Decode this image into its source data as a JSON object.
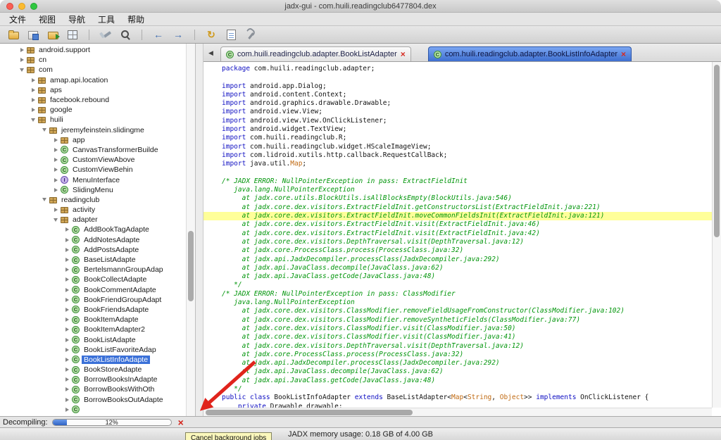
{
  "window": {
    "title": "jadx-gui - com.huili.readingclub6477804.dex"
  },
  "menu_bar": {
    "items": [
      {
        "id": "file",
        "label": "文件"
      },
      {
        "id": "view",
        "label": "视图"
      },
      {
        "id": "navigation",
        "label": "导航"
      },
      {
        "id": "tools",
        "label": "工具"
      },
      {
        "id": "help",
        "label": "帮助"
      }
    ]
  },
  "toolbar": {
    "buttons": [
      {
        "name": "open-file"
      },
      {
        "name": "save-all"
      },
      {
        "name": "export-gradle"
      },
      {
        "name": "reload"
      },
      {
        "sep": true
      },
      {
        "name": "deobfuscation"
      },
      {
        "name": "text-search"
      },
      {
        "sep": true
      },
      {
        "name": "nav-back",
        "glyph": "←"
      },
      {
        "name": "nav-forward",
        "glyph": "→"
      },
      {
        "sep": true
      },
      {
        "name": "sync",
        "glyph": "↻"
      },
      {
        "name": "log-viewer"
      },
      {
        "name": "preferences"
      }
    ]
  },
  "tree": {
    "items": [
      {
        "indent": 1,
        "arrow": "right",
        "icon": "package",
        "label": "android.support"
      },
      {
        "indent": 1,
        "arrow": "right",
        "icon": "package",
        "label": "cn"
      },
      {
        "indent": 1,
        "arrow": "down",
        "icon": "package",
        "label": "com"
      },
      {
        "indent": 2,
        "arrow": "right",
        "icon": "package",
        "label": "amap.api.location"
      },
      {
        "indent": 2,
        "arrow": "right",
        "icon": "package",
        "label": "aps"
      },
      {
        "indent": 2,
        "arrow": "right",
        "icon": "package",
        "label": "facebook.rebound"
      },
      {
        "indent": 2,
        "arrow": "right",
        "icon": "package",
        "label": "google"
      },
      {
        "indent": 2,
        "arrow": "down",
        "icon": "package",
        "label": "huili"
      },
      {
        "indent": 3,
        "arrow": "down",
        "icon": "package",
        "label": "jeremyfeinstein.slidingme"
      },
      {
        "indent": 4,
        "arrow": "right",
        "icon": "package",
        "label": "app"
      },
      {
        "indent": 4,
        "arrow": "right",
        "icon": "class",
        "label": "CanvasTransformerBuilde"
      },
      {
        "indent": 4,
        "arrow": "right",
        "icon": "class",
        "label": "CustomViewAbove"
      },
      {
        "indent": 4,
        "arrow": "right",
        "icon": "class",
        "label": "CustomViewBehin"
      },
      {
        "indent": 4,
        "arrow": "right",
        "icon": "interface",
        "label": "MenuInterface"
      },
      {
        "indent": 4,
        "arrow": "right",
        "icon": "class",
        "label": "SlidingMenu"
      },
      {
        "indent": 3,
        "arrow": "down",
        "icon": "package",
        "label": "readingclub"
      },
      {
        "indent": 4,
        "arrow": "right",
        "icon": "package",
        "label": "activity"
      },
      {
        "indent": 4,
        "arrow": "down",
        "icon": "package",
        "label": "adapter"
      },
      {
        "indent": 5,
        "arrow": "right",
        "icon": "class",
        "label": "AddBookTagAdapte"
      },
      {
        "indent": 5,
        "arrow": "right",
        "icon": "class",
        "label": "AddNotesAdapte"
      },
      {
        "indent": 5,
        "arrow": "right",
        "icon": "class",
        "label": "AddPostsAdapte"
      },
      {
        "indent": 5,
        "arrow": "right",
        "icon": "class",
        "label": "BaseListAdapte"
      },
      {
        "indent": 5,
        "arrow": "right",
        "icon": "class",
        "label": "BertelsmannGroupAdap"
      },
      {
        "indent": 5,
        "arrow": "right",
        "icon": "class",
        "label": "BookCollectAdapte"
      },
      {
        "indent": 5,
        "arrow": "right",
        "icon": "class",
        "label": "BookCommentAdapte"
      },
      {
        "indent": 5,
        "arrow": "right",
        "icon": "class",
        "label": "BookFriendGroupAdapt"
      },
      {
        "indent": 5,
        "arrow": "right",
        "icon": "class",
        "label": "BookFriendsAdapte"
      },
      {
        "indent": 5,
        "arrow": "right",
        "icon": "class",
        "label": "BookItemAdapte"
      },
      {
        "indent": 5,
        "arrow": "right",
        "icon": "class",
        "label": "BookItemAdapter2"
      },
      {
        "indent": 5,
        "arrow": "right",
        "icon": "class",
        "label": "BookListAdapte"
      },
      {
        "indent": 5,
        "arrow": "right",
        "icon": "class",
        "label": "BookListFavoriteAdap"
      },
      {
        "indent": 5,
        "arrow": "right",
        "icon": "class",
        "label": "BookListInfoAdapte",
        "selected": true
      },
      {
        "indent": 5,
        "arrow": "right",
        "icon": "class",
        "label": "BookStoreAdapte"
      },
      {
        "indent": 5,
        "arrow": "right",
        "icon": "class",
        "label": "BorrowBooksInAdapte"
      },
      {
        "indent": 5,
        "arrow": "right",
        "icon": "class",
        "label": "BorrowBooksWithOth"
      },
      {
        "indent": 5,
        "arrow": "right",
        "icon": "class",
        "label": "BorrowBooksOutAdapte"
      },
      {
        "indent": 5,
        "arrow": "right",
        "icon": "class",
        "label": ""
      }
    ]
  },
  "tabs": {
    "items": [
      {
        "label": "com.huili.readingclub.adapter.BookListAdapter",
        "active": false
      },
      {
        "label": "com.huili.readingclub.adapter.BookListInfoAdapter",
        "active": true
      }
    ]
  },
  "editor": {
    "lines": [
      {
        "x": [
          [
            "k",
            "package "
          ],
          [
            "p",
            "com.huili.readingclub.adapter;"
          ]
        ]
      },
      {
        "x": []
      },
      {
        "x": [
          [
            "k",
            "import "
          ],
          [
            "p",
            "android.app.Dialog;"
          ]
        ]
      },
      {
        "x": [
          [
            "k",
            "import "
          ],
          [
            "p",
            "android.content.Context;"
          ]
        ]
      },
      {
        "x": [
          [
            "k",
            "import "
          ],
          [
            "p",
            "android.graphics.drawable.Drawable;"
          ]
        ]
      },
      {
        "x": [
          [
            "k",
            "import "
          ],
          [
            "p",
            "android.view.View;"
          ]
        ]
      },
      {
        "x": [
          [
            "k",
            "import "
          ],
          [
            "p",
            "android.view.View.OnClickListener;"
          ]
        ]
      },
      {
        "x": [
          [
            "k",
            "import "
          ],
          [
            "p",
            "android.widget.TextView;"
          ]
        ]
      },
      {
        "x": [
          [
            "k",
            "import "
          ],
          [
            "p",
            "com.huili.readingclub.R;"
          ]
        ]
      },
      {
        "x": [
          [
            "k",
            "import "
          ],
          [
            "p",
            "com.huili.readingclub.widget.HScaleImageView;"
          ]
        ]
      },
      {
        "x": [
          [
            "k",
            "import "
          ],
          [
            "p",
            "com.lidroid.xutils.http.callback.RequestCallBack;"
          ]
        ]
      },
      {
        "x": [
          [
            "k",
            "import "
          ],
          [
            "p",
            "java.util."
          ],
          [
            "y",
            "Map"
          ],
          [
            "p",
            ";"
          ]
        ]
      },
      {
        "x": []
      },
      {
        "x": [
          [
            "c",
            "/* JADX ERROR: NullPointerException in pass: ExtractFieldInit"
          ]
        ]
      },
      {
        "x": [
          [
            "c",
            "   java.lang.NullPointerException"
          ]
        ]
      },
      {
        "x": [
          [
            "c",
            "     at jadx.core.utils.BlockUtils.isAllBlocksEmpty(BlockUtils.java:546)"
          ]
        ]
      },
      {
        "x": [
          [
            "c",
            "     at jadx.core.dex.visitors.ExtractFieldInit.getConstructorsList(ExtractFieldInit.java:221)"
          ]
        ]
      },
      {
        "h": true,
        "x": [
          [
            "c",
            "     at jadx.core.dex.visitors.ExtractFieldInit.moveCommonFieldsInit(ExtractFieldInit.java:121)"
          ]
        ]
      },
      {
        "x": [
          [
            "c",
            "     at jadx.core.dex.visitors.ExtractFieldInit.visit(ExtractFieldInit.java:46)"
          ]
        ]
      },
      {
        "x": [
          [
            "c",
            "     at jadx.core.dex.visitors.ExtractFieldInit.visit(ExtractFieldInit.java:42)"
          ]
        ]
      },
      {
        "x": [
          [
            "c",
            "     at jadx.core.dex.visitors.DepthTraversal.visit(DepthTraversal.java:12)"
          ]
        ]
      },
      {
        "x": [
          [
            "c",
            "     at jadx.core.ProcessClass.process(ProcessClass.java:32)"
          ]
        ]
      },
      {
        "x": [
          [
            "c",
            "     at jadx.api.JadxDecompiler.processClass(JadxDecompiler.java:292)"
          ]
        ]
      },
      {
        "x": [
          [
            "c",
            "     at jadx.api.JavaClass.decompile(JavaClass.java:62)"
          ]
        ]
      },
      {
        "x": [
          [
            "c",
            "     at jadx.api.JavaClass.getCode(JavaClass.java:48)"
          ]
        ]
      },
      {
        "x": [
          [
            "c",
            "   */"
          ]
        ]
      },
      {
        "x": [
          [
            "c",
            "/* JADX ERROR: NullPointerException in pass: ClassModifier"
          ]
        ]
      },
      {
        "x": [
          [
            "c",
            "   java.lang.NullPointerException"
          ]
        ]
      },
      {
        "x": [
          [
            "c",
            "     at jadx.core.dex.visitors.ClassModifier.removeFieldUsageFromConstructor(ClassModifier.java:102)"
          ]
        ]
      },
      {
        "x": [
          [
            "c",
            "     at jadx.core.dex.visitors.ClassModifier.removeSyntheticFields(ClassModifier.java:77)"
          ]
        ]
      },
      {
        "x": [
          [
            "c",
            "     at jadx.core.dex.visitors.ClassModifier.visit(ClassModifier.java:50)"
          ]
        ]
      },
      {
        "x": [
          [
            "c",
            "     at jadx.core.dex.visitors.ClassModifier.visit(ClassModifier.java:41)"
          ]
        ]
      },
      {
        "x": [
          [
            "c",
            "     at jadx.core.dex.visitors.DepthTraversal.visit(DepthTraversal.java:12)"
          ]
        ]
      },
      {
        "x": [
          [
            "c",
            "     at jadx.core.ProcessClass.process(ProcessClass.java:32)"
          ]
        ]
      },
      {
        "x": [
          [
            "c",
            "     at jadx.api.JadxDecompiler.processClass(JadxDecompiler.java:292)"
          ]
        ]
      },
      {
        "x": [
          [
            "c",
            "     at jadx.api.JavaClass.decompile(JavaClass.java:62)"
          ]
        ]
      },
      {
        "x": [
          [
            "c",
            "     at jadx.api.JavaClass.getCode(JavaClass.java:48)"
          ]
        ]
      },
      {
        "x": [
          [
            "c",
            "   */"
          ]
        ]
      },
      {
        "x": [
          [
            "k",
            "public class "
          ],
          [
            "p",
            "BookListInfoAdapter "
          ],
          [
            "k",
            "extends "
          ],
          [
            "p",
            "BaseListAdapter<"
          ],
          [
            "y",
            "Map"
          ],
          [
            "p",
            "<"
          ],
          [
            "y",
            "String"
          ],
          [
            "p",
            ", "
          ],
          [
            "y",
            "Object"
          ],
          [
            "p",
            ">> "
          ],
          [
            "k",
            "implements "
          ],
          [
            "p",
            "OnClickListener {"
          ]
        ]
      },
      {
        "x": [
          [
            "p",
            "    "
          ],
          [
            "k",
            "private "
          ],
          [
            "p",
            "Drawable drawable;"
          ]
        ]
      }
    ]
  },
  "status_bar": {
    "label": "Decompiling:",
    "progress_text": "12%",
    "progress_fraction": 0.12
  },
  "tooltip": {
    "text": "Cancel background jobs"
  },
  "memory_bar": {
    "text": "JADX memory usage: 0.18 GB of 4.00 GB"
  },
  "colors": {
    "selection_blue": "#3a70d8",
    "active_tab_blue": "#3e6fd0",
    "error_highlight_yellow": "#ffff99",
    "progress_blue": "#2f62c4",
    "annotation_red": "#e0241c"
  }
}
